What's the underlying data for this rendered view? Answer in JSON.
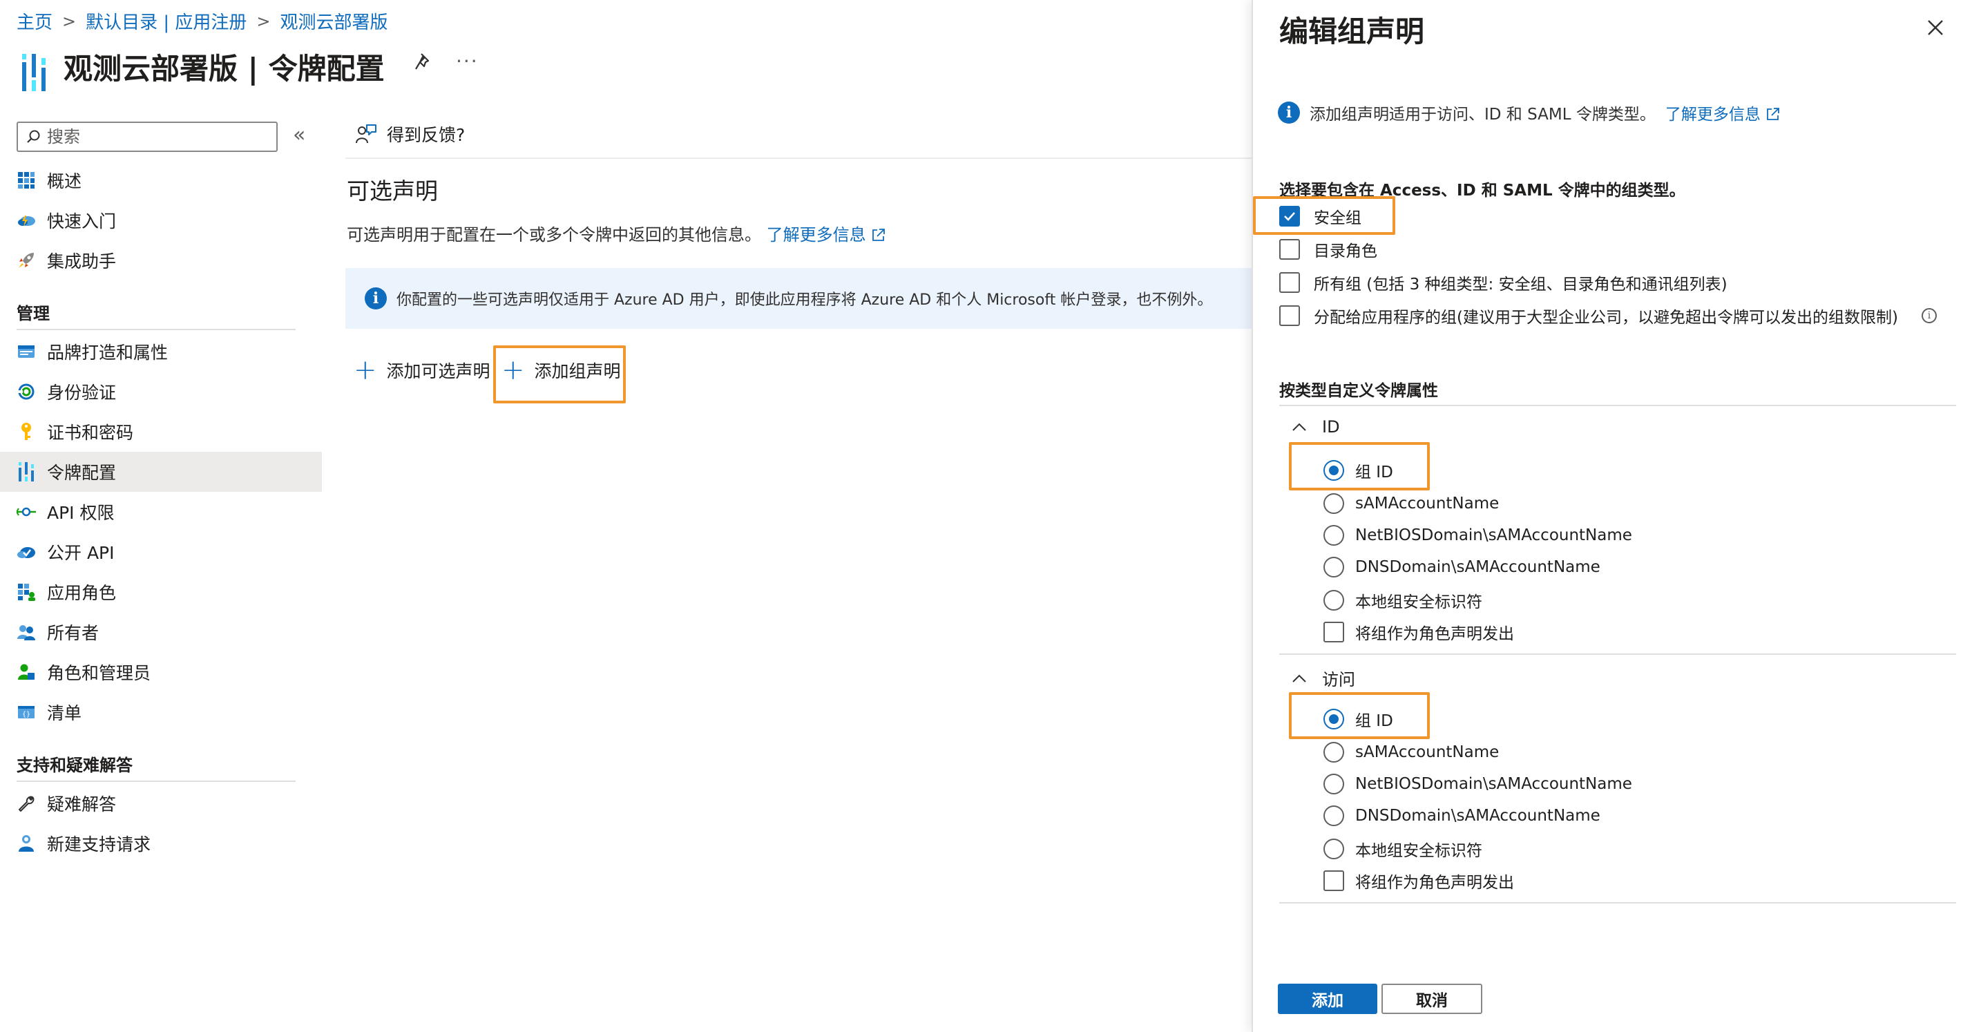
{
  "breadcrumb": [
    "主页",
    "默认目录 | 应用注册",
    "观测云部署版"
  ],
  "page_title": "观测云部署版 | 令牌配置",
  "search": {
    "placeholder": "搜索"
  },
  "nav": {
    "top": [
      {
        "label": "概述",
        "icon": "grid-icon"
      },
      {
        "label": "快速入门",
        "icon": "cloud-lightning-icon"
      },
      {
        "label": "集成助手",
        "icon": "rocket-icon"
      }
    ],
    "manage_title": "管理",
    "manage": [
      {
        "label": "品牌打造和属性",
        "icon": "branding-icon"
      },
      {
        "label": "身份验证",
        "icon": "authentication-icon"
      },
      {
        "label": "证书和密码",
        "icon": "key-icon"
      },
      {
        "label": "令牌配置",
        "icon": "token-config-icon",
        "active": true
      },
      {
        "label": "API 权限",
        "icon": "api-permission-icon"
      },
      {
        "label": "公开 API",
        "icon": "cloud-api-icon"
      },
      {
        "label": "应用角色",
        "icon": "app-roles-icon"
      },
      {
        "label": "所有者",
        "icon": "owners-icon"
      },
      {
        "label": "角色和管理员",
        "icon": "roles-admins-icon"
      },
      {
        "label": "清单",
        "icon": "manifest-icon"
      }
    ],
    "support_title": "支持和疑难解答",
    "support": [
      {
        "label": "疑难解答",
        "icon": "wrench-icon"
      },
      {
        "label": "新建支持请求",
        "icon": "support-request-icon"
      }
    ]
  },
  "main": {
    "feedback": "得到反馈?",
    "section_title": "可选声明",
    "section_desc": "可选声明用于配置在一个或多个令牌中返回的其他信息。",
    "learn_more": "了解更多信息",
    "info": "你配置的一些可选声明仅适用于 Azure AD 用户，即使此应用程序将 Azure AD 和个人 Microsoft 帐户登录，也不例外。",
    "add_optional": "添加可选声明",
    "add_group": "添加组声明"
  },
  "panel": {
    "title": "编辑组声明",
    "info": "添加组声明适用于访问、ID 和 SAML 令牌类型。",
    "learn_more": "了解更多信息",
    "question": "选择要包含在 Access、ID 和 SAML 令牌中的组类型。",
    "group_types": [
      {
        "label": "安全组",
        "checked": true
      },
      {
        "label": "目录角色",
        "checked": false
      },
      {
        "label": "所有组 (包括 3 种组类型: 安全组、目录角色和通讯组列表)",
        "checked": false
      },
      {
        "label": "分配给应用程序的组(建议用于大型企业公司，以避免超出令牌可以发出的组数限制)",
        "checked": false
      }
    ],
    "customize_title": "按类型自定义令牌属性",
    "id_section": {
      "title": "ID",
      "options": [
        "组 ID",
        "sAMAccountName",
        "NetBIOSDomain\\sAMAccountName",
        "DNSDomain\\sAMAccountName",
        "本地组安全标识符"
      ],
      "selected": "组 ID",
      "emit_as_role": "将组作为角色声明发出"
    },
    "access_section": {
      "title": "访问",
      "options": [
        "组 ID",
        "sAMAccountName",
        "NetBIOSDomain\\sAMAccountName",
        "DNSDomain\\sAMAccountName",
        "本地组安全标识符"
      ],
      "selected": "组 ID",
      "emit_as_role": "将组作为角色声明发出"
    },
    "add_button": "添加",
    "cancel_button": "取消"
  },
  "colors": {
    "accent": "#0f6cbd",
    "highlight": "#f0962e",
    "active_nav": "#edebe9",
    "info_bg": "#ebf3fc"
  }
}
